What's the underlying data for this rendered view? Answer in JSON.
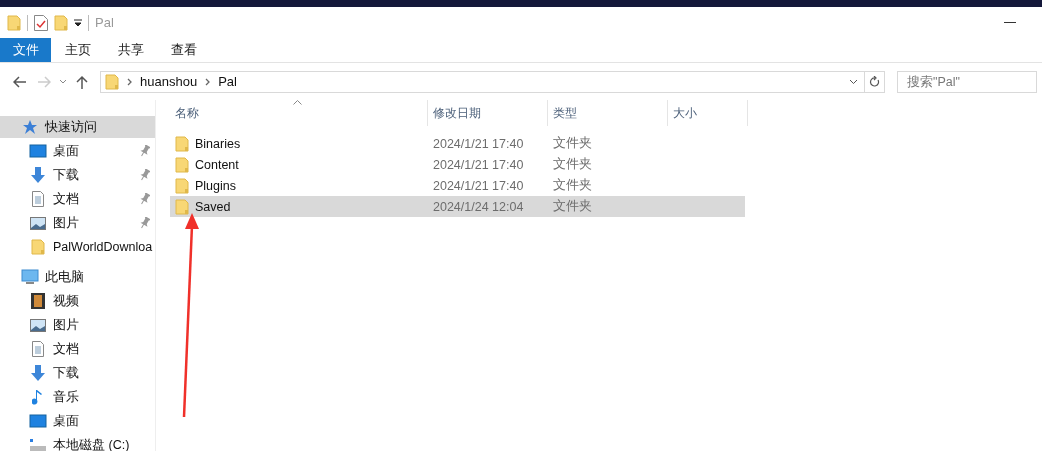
{
  "window": {
    "title": "Pal"
  },
  "ribbon_tabs": [
    {
      "label": "文件",
      "selected": true
    },
    {
      "label": "主页",
      "selected": false
    },
    {
      "label": "共享",
      "selected": false
    },
    {
      "label": "查看",
      "selected": false
    }
  ],
  "address": {
    "path": [
      "huanshou",
      "Pal"
    ]
  },
  "search": {
    "placeholder": "搜索\"Pal\""
  },
  "sidebar": {
    "sections": [
      {
        "label": "快速访问",
        "kind": "quick",
        "selected": true,
        "children": [
          {
            "label": "桌面",
            "kind": "desktop",
            "pinned": true
          },
          {
            "label": "下载",
            "kind": "downloads",
            "pinned": true
          },
          {
            "label": "文档",
            "kind": "documents",
            "pinned": true
          },
          {
            "label": "图片",
            "kind": "pictures",
            "pinned": true
          },
          {
            "label": "PalWorldDownloa",
            "kind": "folder",
            "pinned": false
          }
        ]
      },
      {
        "label": "此电脑",
        "kind": "pc",
        "selected": false,
        "children": [
          {
            "label": "视频",
            "kind": "videos",
            "pinned": false
          },
          {
            "label": "图片",
            "kind": "pictures",
            "pinned": false
          },
          {
            "label": "文档",
            "kind": "documents",
            "pinned": false
          },
          {
            "label": "下载",
            "kind": "downloads",
            "pinned": false
          },
          {
            "label": "音乐",
            "kind": "music",
            "pinned": false
          },
          {
            "label": "桌面",
            "kind": "desktop",
            "pinned": false
          },
          {
            "label": "本地磁盘 (C:)",
            "kind": "drive",
            "pinned": false
          }
        ]
      }
    ]
  },
  "table": {
    "columns": [
      "名称",
      "修改日期",
      "类型",
      "大小"
    ],
    "rows": [
      {
        "name": "Binaries",
        "modified": "2024/1/21 17:40",
        "type": "文件夹",
        "selected": false
      },
      {
        "name": "Content",
        "modified": "2024/1/21 17:40",
        "type": "文件夹",
        "selected": false
      },
      {
        "name": "Plugins",
        "modified": "2024/1/21 17:40",
        "type": "文件夹",
        "selected": false
      },
      {
        "name": "Saved",
        "modified": "2024/1/24 12:04",
        "type": "文件夹",
        "selected": true
      }
    ]
  }
}
